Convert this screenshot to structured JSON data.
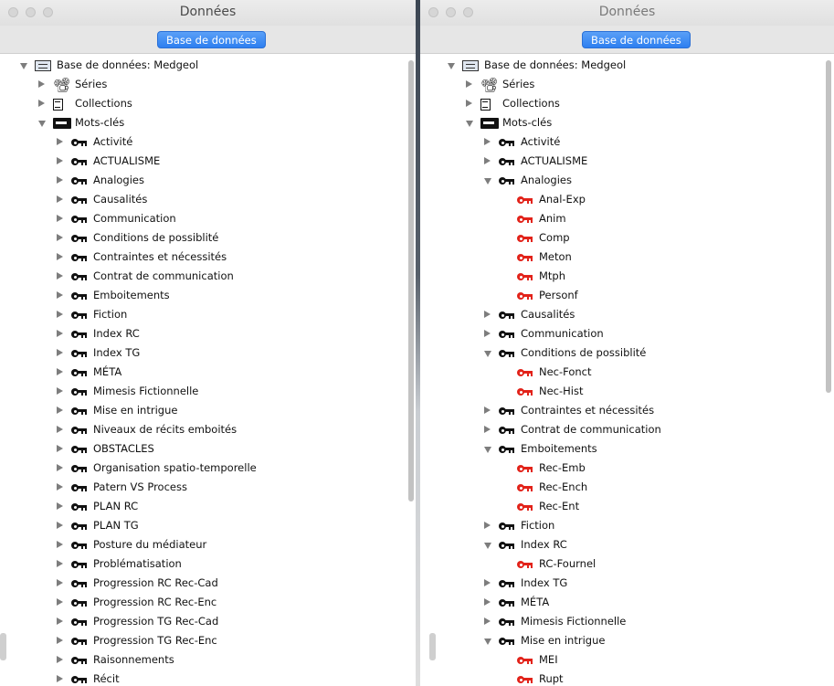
{
  "window_left": {
    "title": "Données",
    "toolbar_button": "Base de données",
    "tree": [
      {
        "label": "Base de données: Medgeol",
        "level": 0,
        "state": "open",
        "icon": "database-icon"
      },
      {
        "label": "Séries",
        "level": 1,
        "state": "closed",
        "icon": "series-icon"
      },
      {
        "label": "Collections",
        "level": 1,
        "state": "closed",
        "icon": "collections-icon"
      },
      {
        "label": "Mots-clés",
        "level": 1,
        "state": "open",
        "icon": "keywords-icon"
      },
      {
        "label": "Activité",
        "level": 2,
        "state": "closed",
        "icon": "key-icon"
      },
      {
        "label": "ACTUALISME",
        "level": 2,
        "state": "closed",
        "icon": "key-icon"
      },
      {
        "label": "Analogies",
        "level": 2,
        "state": "closed",
        "icon": "key-icon"
      },
      {
        "label": "Causalités",
        "level": 2,
        "state": "closed",
        "icon": "key-icon"
      },
      {
        "label": "Communication",
        "level": 2,
        "state": "closed",
        "icon": "key-icon"
      },
      {
        "label": "Conditions de possiblité",
        "level": 2,
        "state": "closed",
        "icon": "key-icon"
      },
      {
        "label": "Contraintes et nécessités",
        "level": 2,
        "state": "closed",
        "icon": "key-icon"
      },
      {
        "label": "Contrat de communication",
        "level": 2,
        "state": "closed",
        "icon": "key-icon"
      },
      {
        "label": "Emboitements",
        "level": 2,
        "state": "closed",
        "icon": "key-icon"
      },
      {
        "label": "Fiction",
        "level": 2,
        "state": "closed",
        "icon": "key-icon"
      },
      {
        "label": "Index RC",
        "level": 2,
        "state": "closed",
        "icon": "key-icon"
      },
      {
        "label": "Index TG",
        "level": 2,
        "state": "closed",
        "icon": "key-icon"
      },
      {
        "label": "MÉTA",
        "level": 2,
        "state": "closed",
        "icon": "key-icon"
      },
      {
        "label": "Mimesis Fictionnelle",
        "level": 2,
        "state": "closed",
        "icon": "key-icon"
      },
      {
        "label": "Mise en intrigue",
        "level": 2,
        "state": "closed",
        "icon": "key-icon"
      },
      {
        "label": "Niveaux de récits emboités",
        "level": 2,
        "state": "closed",
        "icon": "key-icon"
      },
      {
        "label": "OBSTACLES",
        "level": 2,
        "state": "closed",
        "icon": "key-icon"
      },
      {
        "label": "Organisation spatio-temporelle",
        "level": 2,
        "state": "closed",
        "icon": "key-icon"
      },
      {
        "label": "Patern VS Process",
        "level": 2,
        "state": "closed",
        "icon": "key-icon"
      },
      {
        "label": "PLAN RC",
        "level": 2,
        "state": "closed",
        "icon": "key-icon"
      },
      {
        "label": "PLAN TG",
        "level": 2,
        "state": "closed",
        "icon": "key-icon"
      },
      {
        "label": "Posture du médiateur",
        "level": 2,
        "state": "closed",
        "icon": "key-icon"
      },
      {
        "label": "Problématisation",
        "level": 2,
        "state": "closed",
        "icon": "key-icon"
      },
      {
        "label": "Progression RC Rec-Cad",
        "level": 2,
        "state": "closed",
        "icon": "key-icon"
      },
      {
        "label": "Progression RC Rec-Enc",
        "level": 2,
        "state": "closed",
        "icon": "key-icon"
      },
      {
        "label": "Progression TG Rec-Cad",
        "level": 2,
        "state": "closed",
        "icon": "key-icon"
      },
      {
        "label": "Progression TG Rec-Enc",
        "level": 2,
        "state": "closed",
        "icon": "key-icon"
      },
      {
        "label": "Raisonnements",
        "level": 2,
        "state": "closed",
        "icon": "key-icon"
      },
      {
        "label": "Récit",
        "level": 2,
        "state": "closed",
        "icon": "key-icon"
      }
    ]
  },
  "window_right": {
    "title": "Données",
    "toolbar_button": "Base de données",
    "tree": [
      {
        "label": "Base de données: Medgeol",
        "level": 0,
        "state": "open",
        "icon": "database-icon"
      },
      {
        "label": "Séries",
        "level": 1,
        "state": "closed",
        "icon": "series-icon"
      },
      {
        "label": "Collections",
        "level": 1,
        "state": "closed",
        "icon": "collections-icon"
      },
      {
        "label": "Mots-clés",
        "level": 1,
        "state": "open",
        "icon": "keywords-icon"
      },
      {
        "label": "Activité",
        "level": 2,
        "state": "closed",
        "icon": "key-icon"
      },
      {
        "label": "ACTUALISME",
        "level": 2,
        "state": "closed",
        "icon": "key-icon"
      },
      {
        "label": "Analogies",
        "level": 2,
        "state": "open",
        "icon": "key-icon"
      },
      {
        "label": "Anal-Exp",
        "level": 3,
        "state": "leaf",
        "icon": "red-key-icon"
      },
      {
        "label": "Anim",
        "level": 3,
        "state": "leaf",
        "icon": "red-key-icon"
      },
      {
        "label": "Comp",
        "level": 3,
        "state": "leaf",
        "icon": "red-key-icon"
      },
      {
        "label": "Meton",
        "level": 3,
        "state": "leaf",
        "icon": "red-key-icon"
      },
      {
        "label": "Mtph",
        "level": 3,
        "state": "leaf",
        "icon": "red-key-icon"
      },
      {
        "label": "Personf",
        "level": 3,
        "state": "leaf",
        "icon": "red-key-icon"
      },
      {
        "label": "Causalités",
        "level": 2,
        "state": "closed",
        "icon": "key-icon"
      },
      {
        "label": "Communication",
        "level": 2,
        "state": "closed",
        "icon": "key-icon"
      },
      {
        "label": "Conditions de possiblité",
        "level": 2,
        "state": "open",
        "icon": "key-icon"
      },
      {
        "label": "Nec-Fonct",
        "level": 3,
        "state": "leaf",
        "icon": "red-key-icon"
      },
      {
        "label": "Nec-Hist",
        "level": 3,
        "state": "leaf",
        "icon": "red-key-icon"
      },
      {
        "label": "Contraintes et nécessités",
        "level": 2,
        "state": "closed",
        "icon": "key-icon"
      },
      {
        "label": "Contrat de communication",
        "level": 2,
        "state": "closed",
        "icon": "key-icon"
      },
      {
        "label": "Emboitements",
        "level": 2,
        "state": "open",
        "icon": "key-icon"
      },
      {
        "label": "Rec-Emb",
        "level": 3,
        "state": "leaf",
        "icon": "red-key-icon"
      },
      {
        "label": "Rec-Ench",
        "level": 3,
        "state": "leaf",
        "icon": "red-key-icon"
      },
      {
        "label": "Rec-Ent",
        "level": 3,
        "state": "leaf",
        "icon": "red-key-icon"
      },
      {
        "label": "Fiction",
        "level": 2,
        "state": "closed",
        "icon": "key-icon"
      },
      {
        "label": "Index RC",
        "level": 2,
        "state": "open",
        "icon": "key-icon"
      },
      {
        "label": "RC-Fournel",
        "level": 3,
        "state": "leaf",
        "icon": "red-key-icon"
      },
      {
        "label": "Index TG",
        "level": 2,
        "state": "closed",
        "icon": "key-icon"
      },
      {
        "label": "MÉTA",
        "level": 2,
        "state": "closed",
        "icon": "key-icon"
      },
      {
        "label": "Mimesis Fictionnelle",
        "level": 2,
        "state": "closed",
        "icon": "key-icon"
      },
      {
        "label": "Mise en intrigue",
        "level": 2,
        "state": "open",
        "icon": "key-icon"
      },
      {
        "label": "MEI",
        "level": 3,
        "state": "leaf",
        "icon": "red-key-icon"
      },
      {
        "label": "Rupt",
        "level": 3,
        "state": "leaf",
        "icon": "red-key-icon"
      }
    ]
  }
}
